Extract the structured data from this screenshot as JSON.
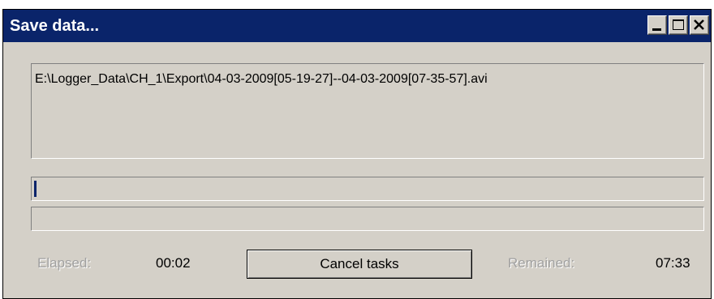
{
  "window": {
    "title": "Save data...",
    "controls": [
      "minimize-icon",
      "maximize-icon",
      "close-icon"
    ]
  },
  "file": {
    "path": "E:\\Logger_Data\\CH_1\\Export\\04-03-2009[05-19-27]--04-03-2009[07-35-57].avi"
  },
  "progress": {
    "current_fraction": 0.004,
    "overall_fraction": 0.0
  },
  "status": {
    "elapsed_label": "Elapsed:",
    "elapsed_value": "00:02",
    "remained_label": "Remained:",
    "remained_value": "07:33"
  },
  "actions": {
    "cancel_label": "Cancel tasks"
  },
  "colors": {
    "titlebar": "#0a246a",
    "face": "#d4d0c8",
    "progress_fill": "#0a246a",
    "disabled_text": "#a0a0a0"
  }
}
